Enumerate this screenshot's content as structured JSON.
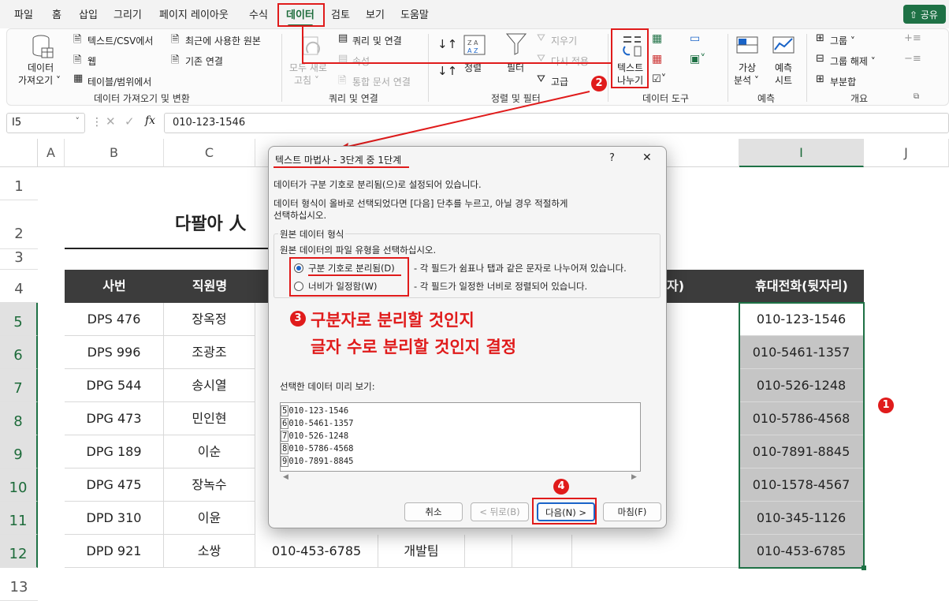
{
  "tabs": [
    "파일",
    "홈",
    "삽입",
    "그리기",
    "페이지 레이아웃",
    "수식",
    "데이터",
    "검토",
    "보기",
    "도움말"
  ],
  "share_label": "공유",
  "ribbon": {
    "get_data_line1": "데이터",
    "get_data_line2": "가져오기",
    "text_csv": "텍스트/CSV에서",
    "web": "웹",
    "table_range": "테이블/범위에서",
    "recent_sources": "최근에 사용한 원본",
    "existing_connections": "기존 연결",
    "group_get_data": "데이터 가져오기 및 변환",
    "refresh_line1": "모두 새로",
    "refresh_line2": "고침",
    "queries_connections": "쿼리 및 연결",
    "properties": "속성",
    "edit_links": "통합 문서 연결",
    "group_queries": "쿼리 및 연결",
    "sort": "정렬",
    "filter": "필터",
    "clear": "지우기",
    "reapply": "다시 적용",
    "advanced": "고급",
    "group_sort_filter": "정렬 및 필터",
    "text_to_columns_line1": "텍스트",
    "text_to_columns_line2": "나누기",
    "group_data_tools": "데이터 도구",
    "whatif_line1": "가상",
    "whatif_line2": "분석",
    "forecast_line1": "예측",
    "forecast_line2": "시트",
    "group_forecast": "예측",
    "group_btn": "그룹",
    "ungroup_btn": "그룹 해제",
    "subtotal_btn": "부분합",
    "group_outline": "개요"
  },
  "formula_bar": {
    "name_box": "I5",
    "fx": "fx",
    "value": "010-123-1546"
  },
  "columns": [
    "A",
    "B",
    "C",
    "I",
    "J"
  ],
  "rows": [
    "1",
    "2",
    "3",
    "4",
    "5",
    "6",
    "7",
    "8",
    "9",
    "10",
    "11",
    "12",
    "13"
  ],
  "sheet": {
    "title_partial": "다팔아 人",
    "headers": {
      "b": "사번",
      "c": "직원명",
      "g_partial": "자)",
      "i": "휴대전화(뒷자리)"
    },
    "rows": [
      {
        "b": "DPS 476",
        "c": "장옥정",
        "i": "010-123-1546"
      },
      {
        "b": "DPS   996",
        "c": "조광조",
        "i": "010-5461-1357"
      },
      {
        "b": "DPG 544",
        "c": "송시열",
        "i": "010-526-1248"
      },
      {
        "b": "DPG 473",
        "c": "민인현",
        "i": "010-5786-4568"
      },
      {
        "b": "DPG 189",
        "c": "이순",
        "i": "010-7891-8845"
      },
      {
        "b": "DPG 475",
        "c": "장녹수",
        "i": "010-1578-4567"
      },
      {
        "b": "DPD 310",
        "c": "이윤",
        "i": "010-345-1126"
      },
      {
        "b": "DPD 921",
        "c": "소쌍",
        "d": "010-453-6785",
        "e": "개발팀",
        "i": "010-453-6785"
      }
    ]
  },
  "dialog": {
    "title": "텍스트 마법사 - 3단계 중 1단계",
    "help": "?",
    "close": "✕",
    "line1": "데이터가 구분 기호로 분리됨(으)로 설정되어 있습니다.",
    "line2": "데이터 형식이 올바로 선택되었다면 [다음] 단추를 누르고, 아닐 경우 적절하게",
    "line3": "선택하십시오.",
    "group_title": "원본 데이터 형식",
    "group_prompt": "원본 데이터의 파일 유형을 선택하십시오.",
    "option_delimited": "구분 기호로 분리됨(D)",
    "option_delimited_desc": "- 각 필드가 쉼표나 탭과 같은 문자로 나누어져 있습니다.",
    "option_fixed": "너비가 일정함(W)",
    "option_fixed_desc": "- 각 필드가 일정한 너비로 정렬되어 있습니다.",
    "preview_label": "선택한 데이터 미리 보기:",
    "preview_rows": [
      {
        "n": "5",
        "v": "010-123-1546"
      },
      {
        "n": "6",
        "v": "010-5461-1357"
      },
      {
        "n": "7",
        "v": "010-526-1248"
      },
      {
        "n": "8",
        "v": "010-5786-4568"
      },
      {
        "n": "9",
        "v": "010-7891-8845"
      }
    ],
    "btn_cancel": "취소",
    "btn_back": "< 뒤로(B)",
    "btn_next": "다음(N) >",
    "btn_finish": "마침(F)"
  },
  "annotation": {
    "badge1": "1",
    "badge2": "2",
    "badge3": "3",
    "badge4": "4",
    "text_line1": "구분자로 분리할 것인지",
    "text_line2": "글자 수로 분리할 것인지 결정"
  },
  "colors": {
    "accent_green": "#1e7145",
    "annotation_red": "#e01b1b",
    "header_dark": "#3c3c3c",
    "selection_gray": "#c5c5c5"
  }
}
